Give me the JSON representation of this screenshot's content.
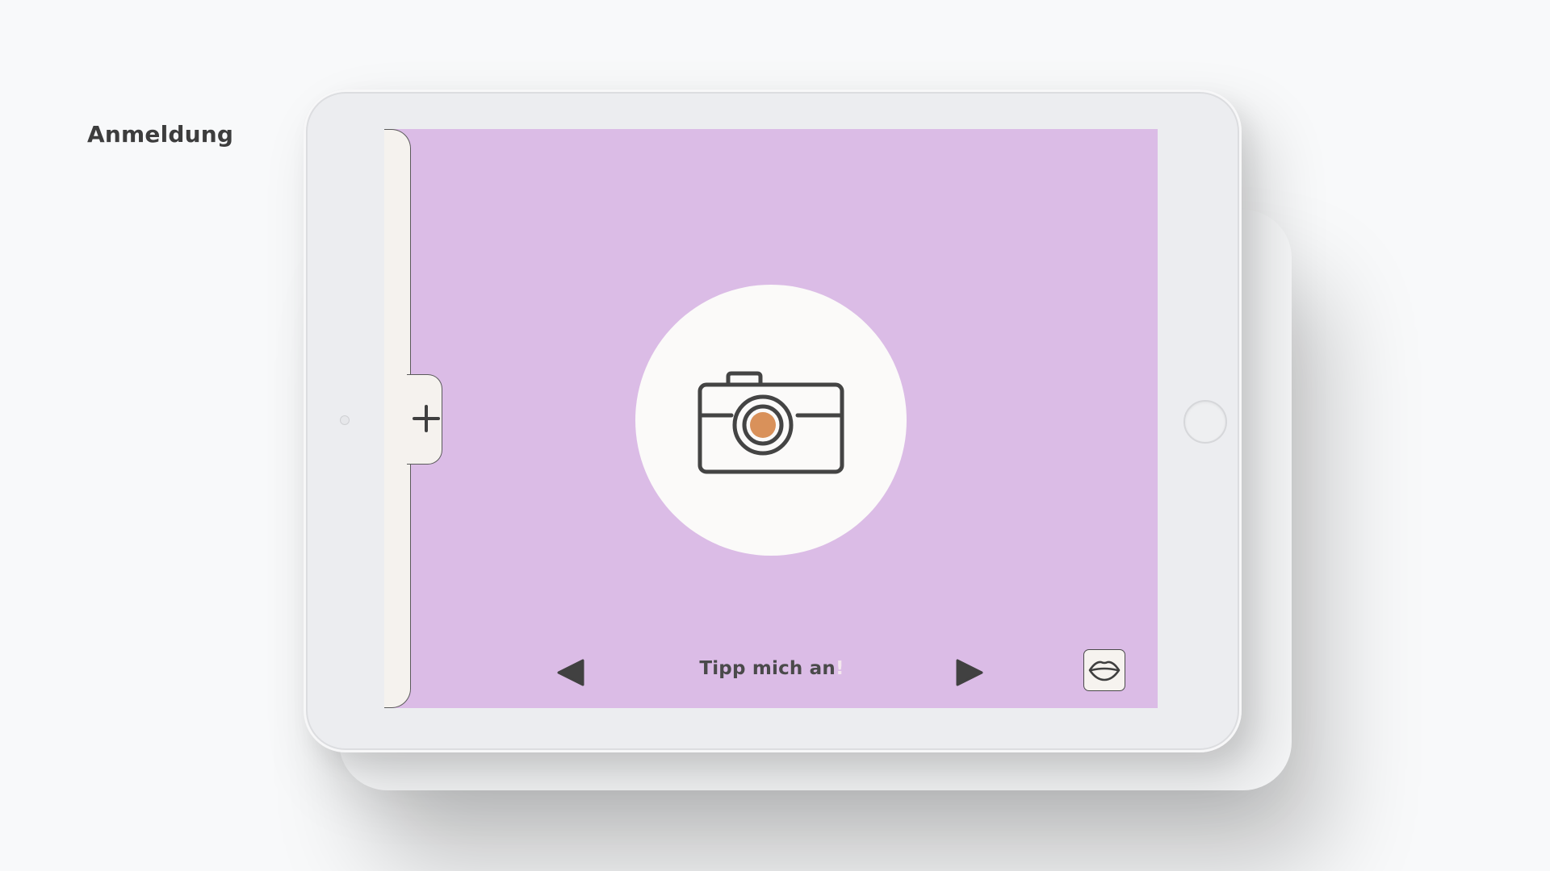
{
  "page": {
    "title": "Anmeldung"
  },
  "screen": {
    "background": "#dbbce6",
    "drawer_color": "#f5f2ee",
    "accent_orange": "#d9915a"
  },
  "sidebar": {
    "add_icon": "plus-icon"
  },
  "main": {
    "photo_icon": "camera-icon"
  },
  "footer": {
    "prev_icon": "triangle-left-icon",
    "hint_text": "Tipp mich an",
    "hint_suffix": "!",
    "next_icon": "triangle-right-icon",
    "speak_icon": "lips-icon"
  }
}
